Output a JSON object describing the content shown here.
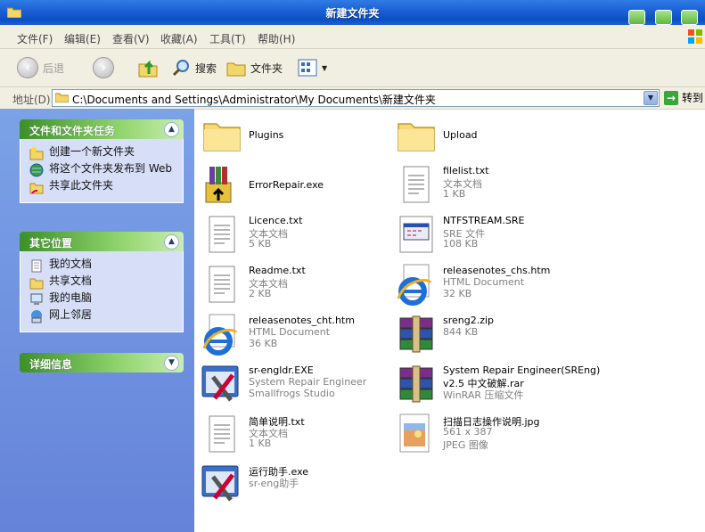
{
  "window": {
    "title": "新建文件夹"
  },
  "menu": [
    "文件(F)",
    "编辑(E)",
    "查看(V)",
    "收藏(A)",
    "工具(T)",
    "帮助(H)"
  ],
  "toolbar": {
    "back": "后退",
    "search": "搜索",
    "folders": "文件夹"
  },
  "address": {
    "label": "地址(D)",
    "path": "C:\\Documents and Settings\\Administrator\\My Documents\\新建文件夹",
    "go": "转到"
  },
  "tasks": {
    "title": "文件和文件夹任务",
    "items": [
      "创建一个新文件夹",
      "将这个文件夹发布到 Web",
      "共享此文件夹"
    ]
  },
  "places": {
    "title": "其它位置",
    "items": [
      "我的文档",
      "共享文档",
      "我的电脑",
      "网上邻居"
    ]
  },
  "details": {
    "title": "详细信息"
  },
  "files": [
    {
      "name": "Plugins",
      "type": "",
      "size": "",
      "icon": "folder-icon"
    },
    {
      "name": "Upload",
      "type": "",
      "size": "",
      "icon": "folder-icon"
    },
    {
      "name": "ErrorRepair.exe",
      "type": "",
      "size": "",
      "icon": "installer-box-icon"
    },
    {
      "name": "filelist.txt",
      "type": "文本文档",
      "size": "1 KB",
      "icon": "text-file-icon"
    },
    {
      "name": "Licence.txt",
      "type": "文本文档",
      "size": "5 KB",
      "icon": "text-file-icon"
    },
    {
      "name": "NTFSTREAM.SRE",
      "type": "SRE 文件",
      "size": "108 KB",
      "icon": "window-file-icon"
    },
    {
      "name": "Readme.txt",
      "type": "文本文档",
      "size": "2 KB",
      "icon": "text-file-icon"
    },
    {
      "name": "releasenotes_chs.htm",
      "type": "HTML Document",
      "size": "32 KB",
      "icon": "ie-icon"
    },
    {
      "name": "releasenotes_cht.htm",
      "type": "HTML Document",
      "size": "36 KB",
      "icon": "ie-icon"
    },
    {
      "name": "sreng2.zip",
      "type": "844 KB",
      "size": "",
      "icon": "winrar-icon"
    },
    {
      "name": "sr-engldr.EXE",
      "type": "System Repair Engineer",
      "size": "Smallfrogs Studio",
      "icon": "tools-app-icon"
    },
    {
      "name": "System Repair Engineer(SREng)",
      "type": "v2.5 中文破解.rar",
      "size": "WinRAR 压缩文件",
      "icon": "winrar-icon"
    },
    {
      "name": "简单说明.txt",
      "type": "文本文档",
      "size": "1 KB",
      "icon": "text-file-icon"
    },
    {
      "name": "扫描日志操作说明.jpg",
      "type": "561 x 387",
      "size": "JPEG 图像",
      "icon": "jpeg-image-icon"
    },
    {
      "name": "运行助手.exe",
      "type": "sr-eng助手",
      "size": "",
      "icon": "tools-app-icon"
    }
  ]
}
